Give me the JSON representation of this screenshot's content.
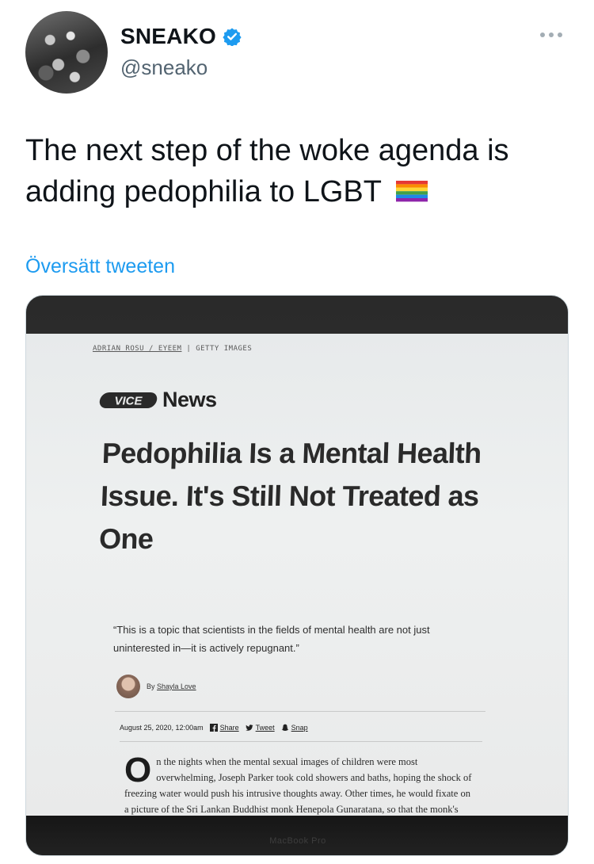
{
  "author": {
    "display_name": "SNEAKO",
    "handle": "@sneako",
    "verified": true
  },
  "tweet": {
    "text": "The next step of the woke agenda is adding pedophilia to LGBT",
    "emoji": "rainbow-flag",
    "translate_label": "Översätt tweeten"
  },
  "icons": {
    "verified": "verified-badge-icon",
    "more": "more-options-icon",
    "flag": "rainbow-flag-icon"
  },
  "colors": {
    "link": "#1d9bf0",
    "verified": "#1d9bf0",
    "secondary_text": "#536471"
  },
  "media": {
    "photo_credit_a": "ADRIAN ROSU / EYEEM",
    "photo_credit_b": "GETTY IMAGES",
    "outlet_logo": "VICE",
    "outlet_name": "News",
    "headline": "Pedophilia Is a Mental Health Issue. It's Still Not Treated as One",
    "subhead": "“This is a topic that scientists in the fields of mental health are not just uninterested in—it is actively repugnant.”",
    "byline_prefix": "By",
    "byline_author": "Shayla Love",
    "date": "August 25, 2020, 12:00am",
    "share_facebook": "Share",
    "share_twitter": "Tweet",
    "share_snap": "Snap",
    "dropcap": "O",
    "article_text": "n the nights when the mental sexual images of children were most overwhelming, Joseph Parker took cold showers and baths, hoping the shock of freezing water would push his intrusive thoughts away. Other times, he would fixate on a picture of the Sri Lankan Buddhist monk Henepola Gunaratana, so that the monk's \"wrinkly face\" might replace the disturbing imagery in his head.",
    "laptop_label": "MacBook Pro"
  }
}
